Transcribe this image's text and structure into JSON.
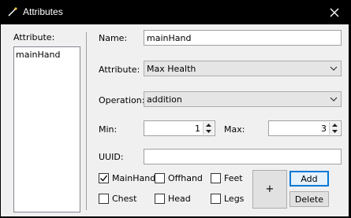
{
  "window": {
    "title": "Attributes",
    "icon": "wand-icon",
    "close_icon": "close-icon"
  },
  "list": {
    "label": "Attribute:",
    "items": [
      "mainHand"
    ]
  },
  "form": {
    "name_label": "Name:",
    "name_value": "mainHand",
    "attribute_label": "Attribute:",
    "attribute_value": "Max Health",
    "operation_label": "Operation:",
    "operation_value": "addition",
    "min_label": "Min:",
    "min_value": "1",
    "max_label": "Max:",
    "max_value": "3",
    "uuid_label": "UUID:",
    "uuid_value": ""
  },
  "slots": [
    {
      "label": "MainHand",
      "checked": true
    },
    {
      "label": "Offhand",
      "checked": false
    },
    {
      "label": "Feet",
      "checked": false
    },
    {
      "label": "Chest",
      "checked": false
    },
    {
      "label": "Head",
      "checked": false
    },
    {
      "label": "Legs",
      "checked": false
    }
  ],
  "buttons": {
    "plus": "+",
    "add": "Add",
    "delete": "Delete"
  }
}
